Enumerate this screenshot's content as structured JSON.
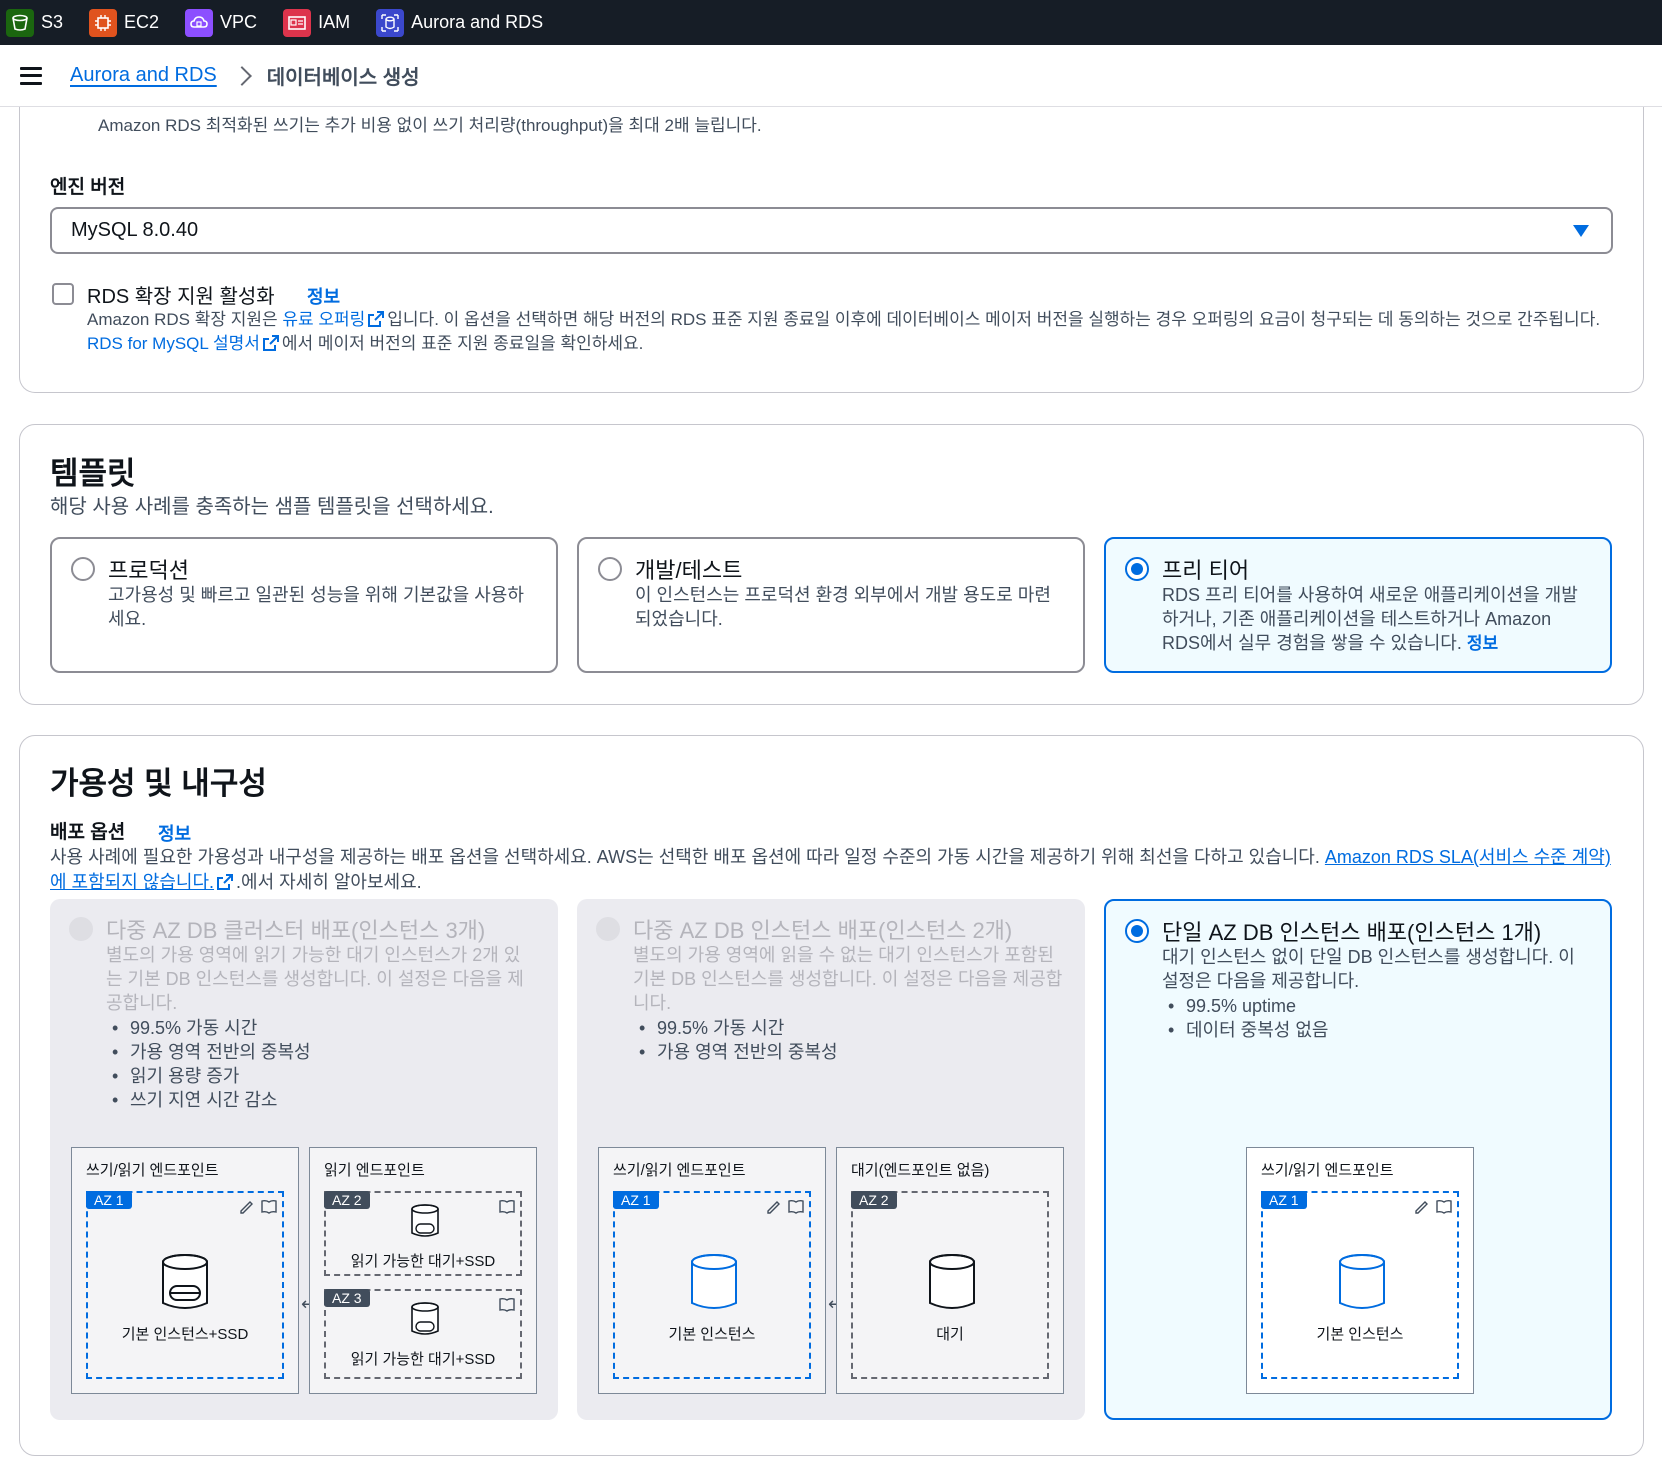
{
  "topbar": {
    "services": [
      {
        "label": "S3",
        "icon": "s3-bucket-icon",
        "color": "#1b660f"
      },
      {
        "label": "EC2",
        "icon": "ec2-chip-icon",
        "color": "#e0531e"
      },
      {
        "label": "VPC",
        "icon": "vpc-cloud-icon",
        "color": "#8c4fff"
      },
      {
        "label": "IAM",
        "icon": "iam-id-icon",
        "color": "#dd344c"
      },
      {
        "label": "Aurora and RDS",
        "icon": "rds-database-icon",
        "color": "#3b48cc"
      }
    ]
  },
  "breadcrumb": {
    "parent": "Aurora and RDS",
    "current": "데이터베이스 생성"
  },
  "engine": {
    "optimized_writes_desc": "Amazon RDS 최적화된 쓰기는 추가 비용 없이 쓰기 처리량(throughput)을 최대 2배 늘립니다.",
    "version_label": "엔진 버전",
    "version_value": "MySQL 8.0.40",
    "extended_support_label": "RDS 확장 지원 활성화",
    "extended_support_info": "정보",
    "extended_support_desc_1": "Amazon RDS 확장 지원은 ",
    "extended_support_link_1": "유료 오퍼링",
    "extended_support_desc_2": "입니다. 이 옵션을 선택하면 해당 버전의 RDS 표준 지원 종료일 이후에 데이터베이스 메이저 버전을 실행하는 경우 오퍼링의 요금이 청구되는 데 동의하는 것으로 간주됩니다. ",
    "extended_support_link_2": "RDS for MySQL 설명서",
    "extended_support_desc_3": "에서 메이저 버전의 표준 지원 종료일을 확인하세요."
  },
  "templates": {
    "title": "템플릿",
    "subtitle": "해당 사용 사례를 충족하는 샘플 템플릿을 선택하세요.",
    "options": [
      {
        "title": "프로덕션",
        "desc": "고가용성 및 빠르고 일관된 성능을 위해 기본값을 사용하세요.",
        "selected": false
      },
      {
        "title": "개발/테스트",
        "desc": "이 인스턴스는 프로덕션 환경 외부에서 개발 용도로 마련되었습니다.",
        "selected": false
      },
      {
        "title": "프리 티어",
        "desc": "RDS 프리 티어를 사용하여 새로운 애플리케이션을 개발하거나, 기존 애플리케이션을 테스트하거나 Amazon RDS에서 실무 경험을 쌓을 수 있습니다. ",
        "info": "정보",
        "selected": true
      }
    ]
  },
  "availability": {
    "title": "가용성 및 내구성",
    "deploy_label": "배포 옵션",
    "deploy_info": "정보",
    "deploy_desc": "사용 사례에 필요한 가용성과 내구성을 제공하는 배포 옵션을 선택하세요. AWS는 선택한 배포 옵션에 따라 일정 수준의 가동 시간을 제공하기 위해 최선을 다하고 있습니다. ",
    "deploy_link": "Amazon RDS SLA(서비스 수준 계약)에 포함되지 않습니다.",
    "deploy_desc_end": ".에서 자세히 알아보세요.",
    "options": [
      {
        "title": "다중 AZ DB 클러스터 배포(인스턴스 3개)",
        "desc": "별도의 가용 영역에 읽기 가능한 대기 인스턴스가 2개 있는 기본 DB 인스턴스를 생성합니다. 이 설정은 다음을 제공합니다.",
        "bullets": [
          "99.5% 가동 시간",
          "가용 영역 전반의 중복성",
          "읽기 용량 증가",
          "쓰기 지연 시간 감소"
        ],
        "enabled": false
      },
      {
        "title": "다중 AZ DB 인스턴스 배포(인스턴스 2개)",
        "desc": "별도의 가용 영역에 읽을 수 없는 대기 인스턴스가 포함된 기본 DB 인스턴스를 생성합니다. 이 설정은 다음을 제공합니다.",
        "bullets": [
          "99.5% 가동 시간",
          "가용 영역 전반의 중복성"
        ],
        "enabled": false
      },
      {
        "title": "단일 AZ DB 인스턴스 배포(인스턴스 1개)",
        "desc": "대기 인스턴스 없이 단일 DB 인스턴스를 생성합니다. 이 설정은 다음을 제공합니다.",
        "bullets": [
          "99.5% uptime",
          "데이터 중복성 없음"
        ],
        "enabled": true,
        "selected": true
      }
    ],
    "diagrams": {
      "rw_endpoint": "쓰기/읽기 엔드포인트",
      "read_endpoint": "읽기 엔드포인트",
      "standby_no_endpoint": "대기(엔드포인트 없음)",
      "az1": "AZ 1",
      "az2": "AZ 2",
      "az3": "AZ 3",
      "primary_ssd": "기본 인스턴스+SSD",
      "readable_standby_ssd": "읽기 가능한 대기+SSD",
      "primary": "기본 인스턴스",
      "standby": "대기"
    }
  }
}
